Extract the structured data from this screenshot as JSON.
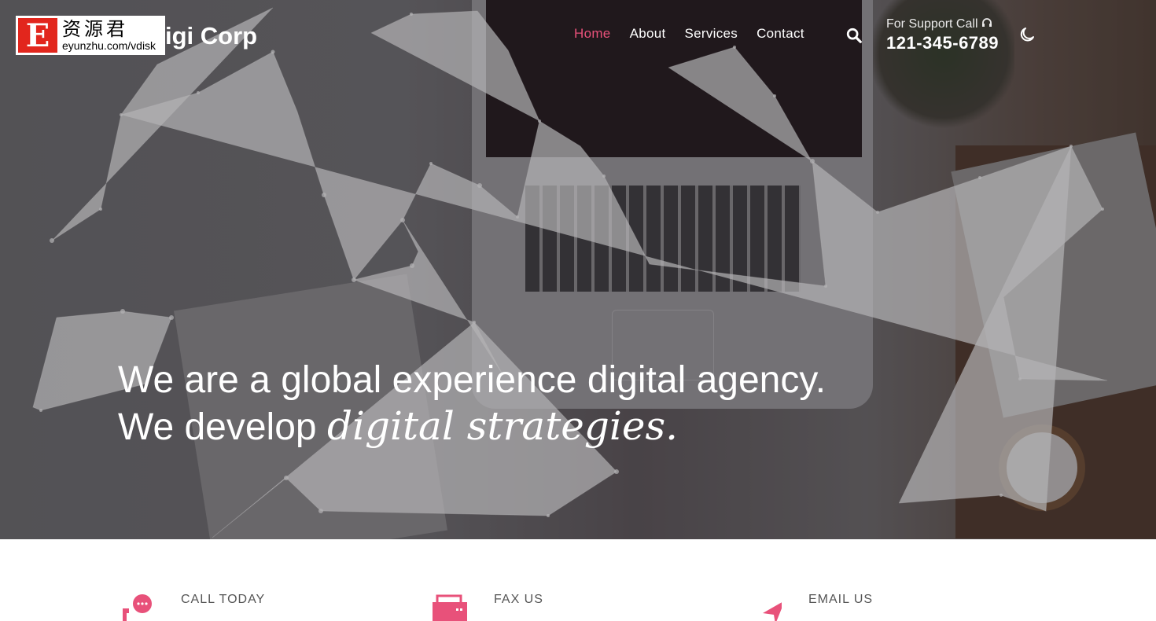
{
  "header": {
    "logo_cn": "资源君",
    "logo_url": "eyunzhu.com/vdisk",
    "logo_letter": "E",
    "brand": "igi Corp",
    "nav": [
      {
        "label": "Home",
        "active": true
      },
      {
        "label": "About"
      },
      {
        "label": "Services"
      },
      {
        "label": "Contact"
      }
    ],
    "support_label": "For Support Call",
    "support_phone": "121-345-6789"
  },
  "hero": {
    "line1": "We are a global experience digital agency.",
    "line2_prefix": "We develop ",
    "line2_emphasis": "digital strategies."
  },
  "contact": [
    {
      "label": "CALL TODAY",
      "icon": "chat-phone-icon"
    },
    {
      "label": "FAX US",
      "icon": "fax-icon"
    },
    {
      "label": "EMAIL US",
      "icon": "paper-plane-icon"
    }
  ],
  "colors": {
    "accent": "#e8517a"
  }
}
